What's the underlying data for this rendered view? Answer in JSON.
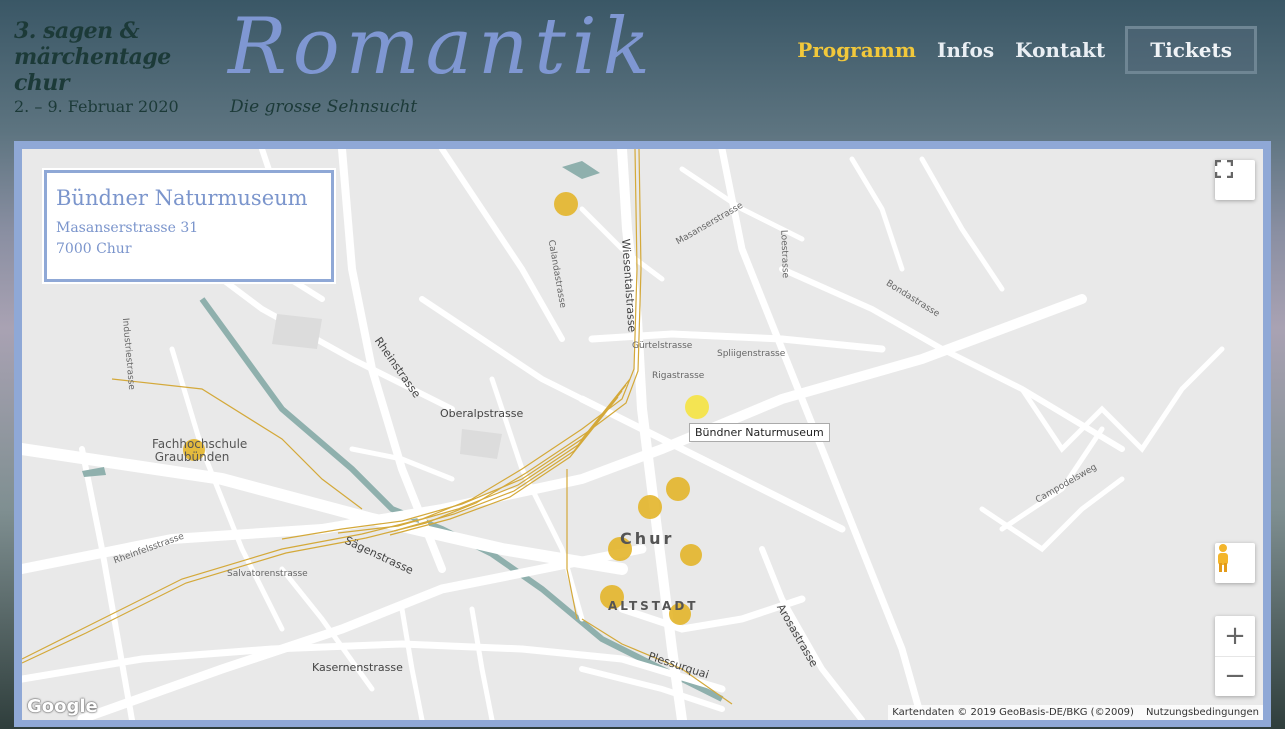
{
  "header": {
    "festival_lines": [
      "3. sagen &",
      "märchentage",
      "chur"
    ],
    "dates": "2. – 9. Februar 2020",
    "logo_title": "Romantik",
    "logo_subtitle": "Die grosse Sehnsucht"
  },
  "nav": {
    "items": [
      "Programm",
      "Infos",
      "Kontakt"
    ],
    "active": "Programm",
    "tickets": "Tickets",
    "active_color": "#f2c83b"
  },
  "map": {
    "info_card": {
      "name": "Bündner Naturmuseum",
      "address_line1": "Masanserstrasse 31",
      "address_line2": "7000 Chur"
    },
    "tooltip": "Bündner Naturmuseum",
    "city_label": "Chur",
    "district_label": "ALTSTADT",
    "poi_label": "Fachhochschule Graubünden",
    "street_labels": [
      "Gürtelstrasse",
      "Oberalpstrasse",
      "Rheinstrasse",
      "Sägenstrasse",
      "Kasernenstrasse",
      "Plessurquai",
      "Arosastrasse",
      "Wiesentalstrasse",
      "Bondastrasse",
      "Rigastrasse",
      "Spliigenstrasse",
      "Industriestrasse",
      "Rheinfelsstrasse",
      "Salvatorenstrasse",
      "Campodelsweg",
      "Loestrasse",
      "Masanserstrasse",
      "Calandastrasse"
    ],
    "attribution": "Kartendaten © 2019 GeoBasis-DE/BKG (©2009)",
    "terms": "Nutzungsbedingungen",
    "google_logo": "Google",
    "zoom_in": "+",
    "zoom_out": "−",
    "marker_color": "#e3b52a",
    "selected_marker_color": "#f4e44a"
  }
}
